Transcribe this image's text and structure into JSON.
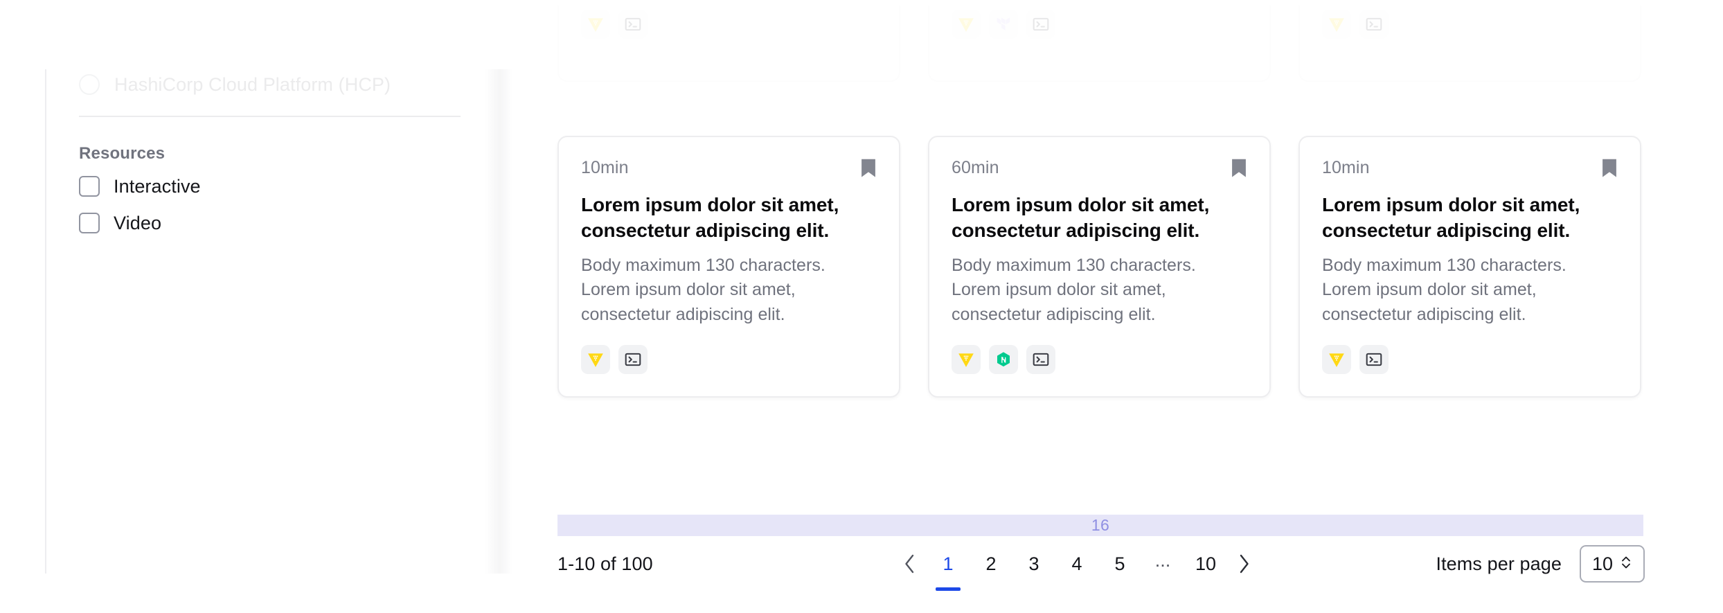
{
  "sidebar": {
    "product_filter": {
      "label": "HashiCorp Cloud Platform (HCP)",
      "selected": false
    },
    "resources": {
      "heading": "Resources",
      "options": [
        {
          "label": "Interactive",
          "checked": false
        },
        {
          "label": "Video",
          "checked": false
        }
      ]
    }
  },
  "content": {
    "cards_top_clipped": [
      {
        "badges": [
          "vault-icon",
          "terminal-icon"
        ]
      },
      {
        "badges": [
          "vault-icon",
          "terraform-icon",
          "terminal-icon"
        ]
      },
      {
        "badges": [
          "vault-icon",
          "terminal-icon"
        ]
      }
    ],
    "cards": [
      {
        "duration": "10min",
        "title": "Lorem ipsum dolor sit amet, consectetur adipiscing elit.",
        "body": "Body maximum 130 characters. Lorem ipsum dolor sit amet, consectetur adipiscing elit.",
        "bookmark_icon": "bookmark-icon",
        "badges": [
          "vault-icon",
          "terminal-icon"
        ]
      },
      {
        "duration": "60min",
        "title": "Lorem ipsum dolor sit amet, consectetur adipiscing elit.",
        "body": "Body maximum 130 characters. Lorem ipsum dolor sit amet, consectetur adipiscing elit.",
        "bookmark_icon": "bookmark-icon",
        "badges": [
          "vault-icon",
          "nomad-icon",
          "terminal-icon"
        ]
      },
      {
        "duration": "10min",
        "title": "Lorem ipsum dolor sit amet, consectetur adipiscing elit.",
        "body": "Body maximum 130 characters. Lorem ipsum dolor sit amet, consectetur adipiscing elit.",
        "bookmark_icon": "bookmark-icon",
        "badges": [
          "vault-icon",
          "terminal-icon"
        ]
      }
    ]
  },
  "spacing_annotation": {
    "label": "16"
  },
  "pagination": {
    "summary": "1-10 of 100",
    "prev_icon": "chevron-left-icon",
    "next_icon": "chevron-right-icon",
    "pages": [
      "1",
      "2",
      "3",
      "4",
      "5"
    ],
    "ellipsis": "...",
    "last_page": "10",
    "current_page": "1",
    "per_page_label": "Items per page",
    "per_page_value": "10",
    "per_page_icon": "chevron-updown-icon"
  },
  "colors": {
    "accent_blue": "#1c49e8",
    "annotation_lavender": "#e6e5f8",
    "annotation_text": "#8f8fe2",
    "vault_yellow": "#ffd814",
    "nomad_green": "#00ca8e",
    "terraform_purple": "#c8bdf5",
    "badge_bg": "#f1f2f4"
  }
}
